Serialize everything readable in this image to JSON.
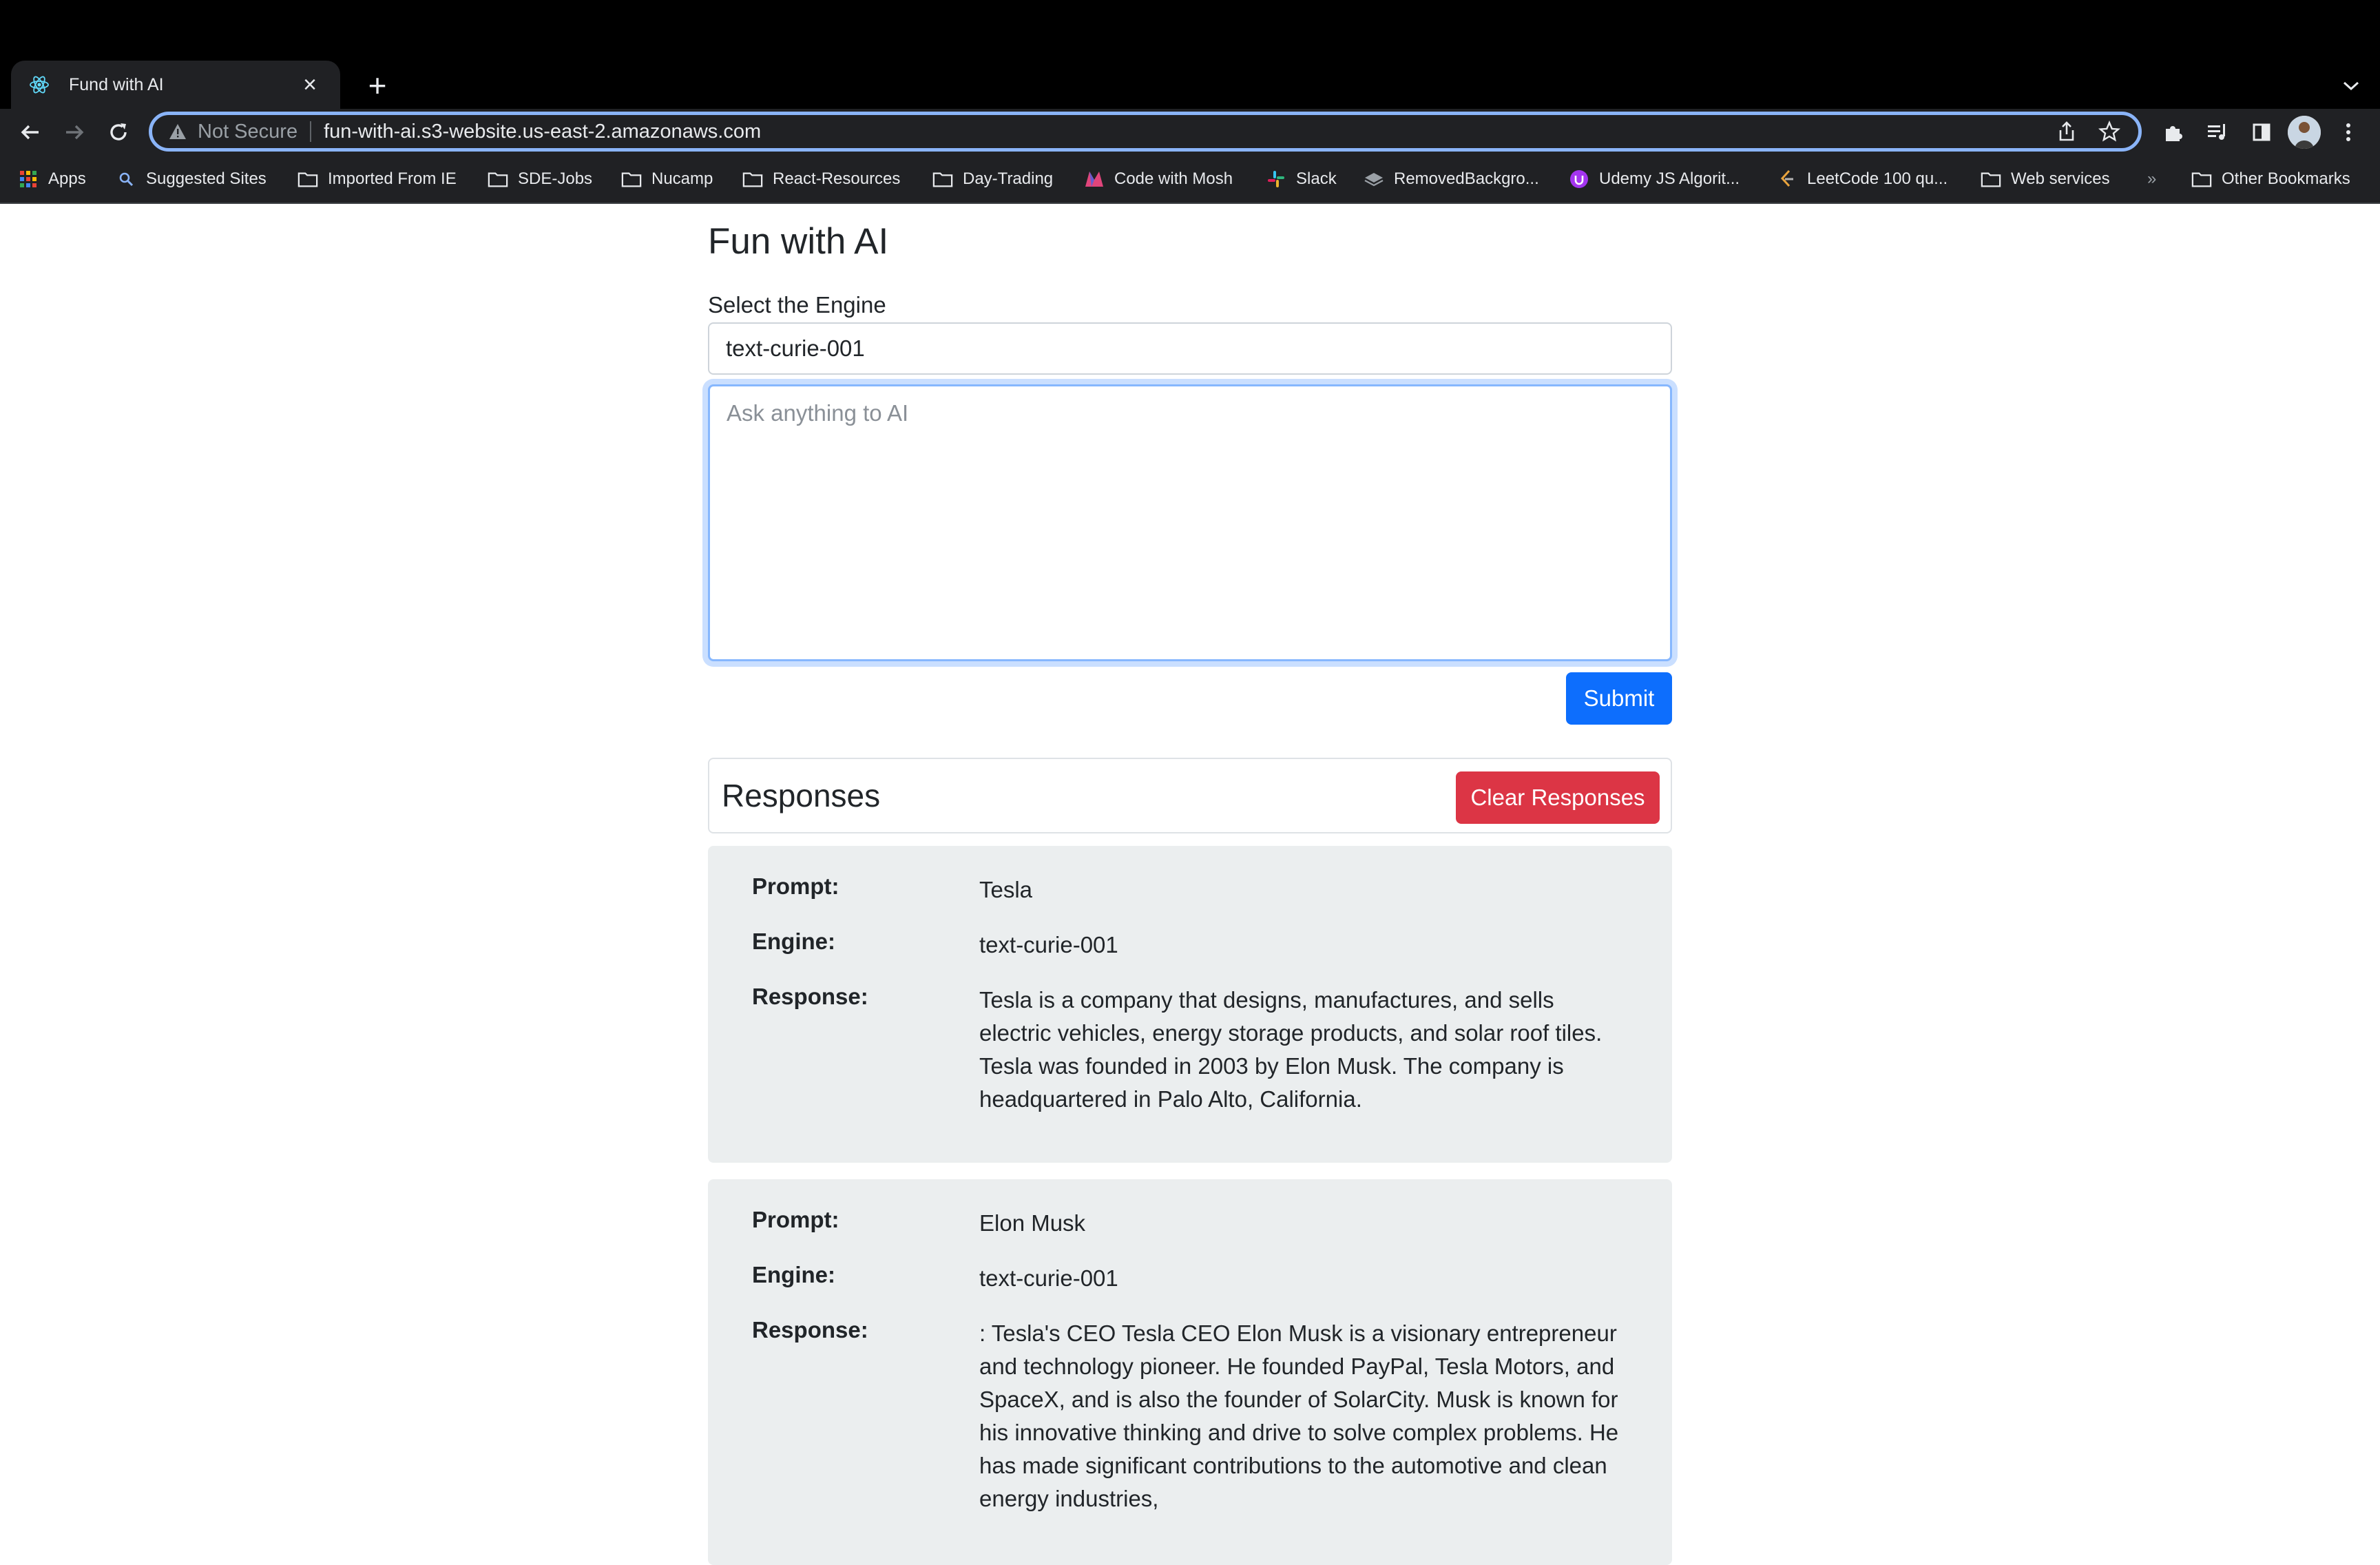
{
  "browser": {
    "tab_title": "Fund with AI",
    "security_label": "Not Secure",
    "url": "fun-with-ai.s3-website.us-east-2.amazonaws.com",
    "bookmarks": [
      {
        "label": "Apps",
        "icon": "apps-grid-icon"
      },
      {
        "label": "Suggested Sites",
        "icon": "search-icon"
      },
      {
        "label": "Imported From IE",
        "icon": "folder-icon"
      },
      {
        "label": "SDE-Jobs",
        "icon": "folder-icon"
      },
      {
        "label": "Nucamp",
        "icon": "folder-icon"
      },
      {
        "label": "React-Resources",
        "icon": "folder-icon"
      },
      {
        "label": "Day-Trading",
        "icon": "folder-icon"
      },
      {
        "label": "Code with Mosh",
        "icon": "mosh-logo-icon"
      },
      {
        "label": "Slack",
        "icon": "slack-logo-icon"
      },
      {
        "label": "RemovedBackgro...",
        "icon": "layers-icon"
      },
      {
        "label": "Udemy JS Algorit...",
        "icon": "udemy-logo-icon"
      },
      {
        "label": "LeetCode 100 qu...",
        "icon": "leetcode-logo-icon"
      },
      {
        "label": "Web services",
        "icon": "folder-icon"
      }
    ],
    "overflow_label": "»",
    "other_bookmarks": "Other Bookmarks"
  },
  "page": {
    "title": "Fun with AI",
    "engine_label": "Select the Engine",
    "engine_value": "text-curie-001",
    "prompt_placeholder": "Ask anything to AI",
    "prompt_value": "",
    "submit_label": "Submit",
    "responses_title": "Responses",
    "clear_label": "Clear Responses",
    "labels": {
      "prompt": "Prompt:",
      "engine": "Engine:",
      "response": "Response:"
    },
    "responses": [
      {
        "prompt": "Tesla",
        "engine": "text-curie-001",
        "response": "Tesla is a company that designs, manufactures, and sells electric vehicles, energy storage products, and solar roof tiles. Tesla was founded in 2003 by Elon Musk. The company is headquartered in Palo Alto, California."
      },
      {
        "prompt": "Elon Musk",
        "engine": "text-curie-001",
        "response": ": Tesla's CEO Tesla CEO Elon Musk is a visionary entrepreneur and technology pioneer. He founded PayPal, Tesla Motors, and SpaceX, and is also the founder of SolarCity. Musk is known for his innovative thinking and drive to solve complex problems. He has made significant contributions to the automotive and clean energy industries,"
      }
    ]
  },
  "colors": {
    "primary": "#0d6efd",
    "danger": "#dc3545",
    "response_bg": "#ebeeef",
    "focus_ring": "#86b7fe"
  }
}
